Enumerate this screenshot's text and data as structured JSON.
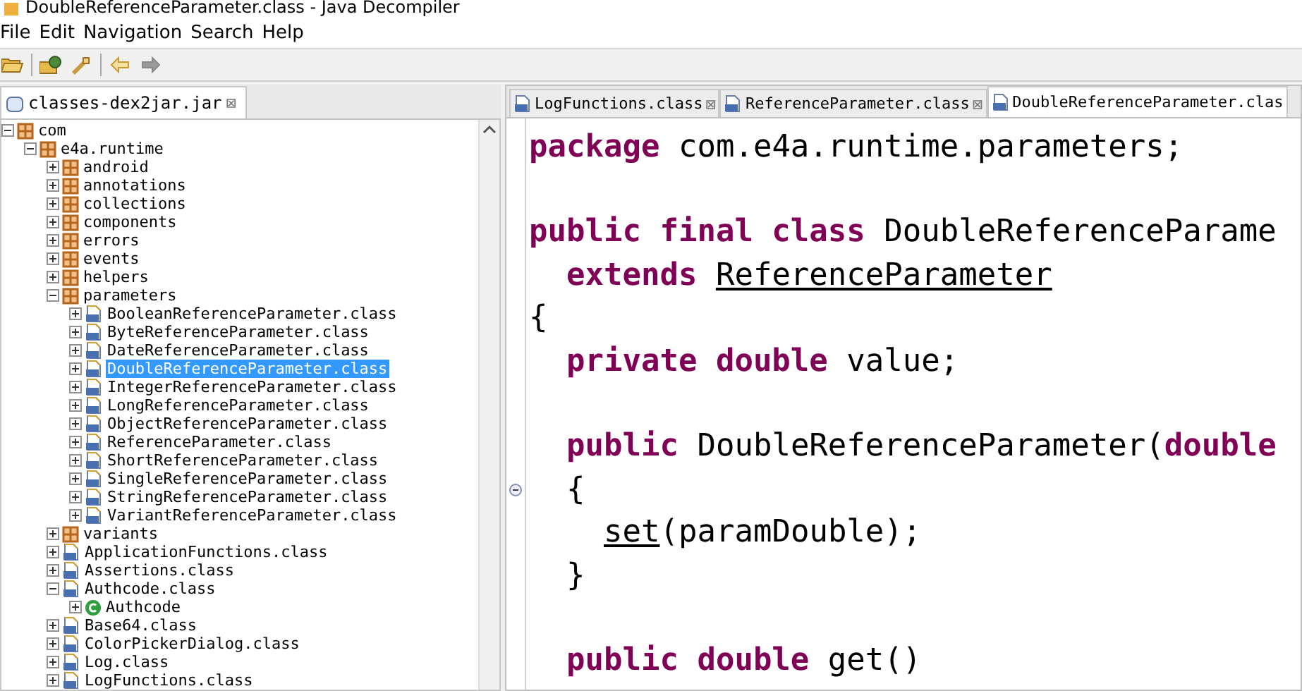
{
  "window": {
    "title": "DoubleReferenceParameter.class - Java Decompiler"
  },
  "menu": [
    "File",
    "Edit",
    "Navigation",
    "Search",
    "Help"
  ],
  "toolbar": {
    "back_enabled": true,
    "forward_enabled": false
  },
  "left_tab": {
    "label": "classes-dex2jar.jar",
    "close": "⊠"
  },
  "tree": [
    {
      "label": "com",
      "kind": "package",
      "expanded": true,
      "selected": false,
      "children": [
        {
          "label": "e4a.runtime",
          "kind": "package",
          "expanded": true,
          "selected": false,
          "children": [
            {
              "label": "android",
              "kind": "package",
              "expanded": false,
              "selected": false
            },
            {
              "label": "annotations",
              "kind": "package",
              "expanded": false,
              "selected": false
            },
            {
              "label": "collections",
              "kind": "package",
              "expanded": false,
              "selected": false
            },
            {
              "label": "components",
              "kind": "package",
              "expanded": false,
              "selected": false
            },
            {
              "label": "errors",
              "kind": "package",
              "expanded": false,
              "selected": false
            },
            {
              "label": "events",
              "kind": "package",
              "expanded": false,
              "selected": false
            },
            {
              "label": "helpers",
              "kind": "package",
              "expanded": false,
              "selected": false
            },
            {
              "label": "parameters",
              "kind": "package",
              "expanded": true,
              "selected": false,
              "children": [
                {
                  "label": "BooleanReferenceParameter.class",
                  "kind": "file",
                  "expanded": false,
                  "selected": false
                },
                {
                  "label": "ByteReferenceParameter.class",
                  "kind": "file",
                  "expanded": false,
                  "selected": false
                },
                {
                  "label": "DateReferenceParameter.class",
                  "kind": "file",
                  "expanded": false,
                  "selected": false
                },
                {
                  "label": "DoubleReferenceParameter.class",
                  "kind": "file",
                  "expanded": false,
                  "selected": true
                },
                {
                  "label": "IntegerReferenceParameter.class",
                  "kind": "file",
                  "expanded": false,
                  "selected": false
                },
                {
                  "label": "LongReferenceParameter.class",
                  "kind": "file",
                  "expanded": false,
                  "selected": false
                },
                {
                  "label": "ObjectReferenceParameter.class",
                  "kind": "file",
                  "expanded": false,
                  "selected": false
                },
                {
                  "label": "ReferenceParameter.class",
                  "kind": "file",
                  "expanded": false,
                  "selected": false
                },
                {
                  "label": "ShortReferenceParameter.class",
                  "kind": "file",
                  "expanded": false,
                  "selected": false
                },
                {
                  "label": "SingleReferenceParameter.class",
                  "kind": "file",
                  "expanded": false,
                  "selected": false
                },
                {
                  "label": "StringReferenceParameter.class",
                  "kind": "file",
                  "expanded": false,
                  "selected": false
                },
                {
                  "label": "VariantReferenceParameter.class",
                  "kind": "file",
                  "expanded": false,
                  "selected": false
                }
              ]
            },
            {
              "label": "variants",
              "kind": "package",
              "expanded": false,
              "selected": false
            },
            {
              "label": "ApplicationFunctions.class",
              "kind": "file",
              "expanded": false,
              "selected": false
            },
            {
              "label": "Assertions.class",
              "kind": "file",
              "expanded": false,
              "selected": false
            },
            {
              "label": "Authcode.class",
              "kind": "file",
              "expanded": true,
              "selected": false,
              "children": [
                {
                  "label": "Authcode",
                  "kind": "class",
                  "expanded": false,
                  "selected": false
                }
              ]
            },
            {
              "label": "Base64.class",
              "kind": "file",
              "expanded": false,
              "selected": false
            },
            {
              "label": "ColorPickerDialog.class",
              "kind": "file",
              "expanded": false,
              "selected": false
            },
            {
              "label": "Log.class",
              "kind": "file",
              "expanded": false,
              "selected": false
            },
            {
              "label": "LogFunctions.class",
              "kind": "file",
              "expanded": false,
              "selected": false
            }
          ]
        }
      ]
    }
  ],
  "editor_tabs": [
    {
      "label": "LogFunctions.class",
      "close": "⊠",
      "selected": false
    },
    {
      "label": "ReferenceParameter.class",
      "close": "⊠",
      "selected": false
    },
    {
      "label": "DoubleReferenceParameter.clas",
      "selected": true
    }
  ],
  "code": [
    {
      "kind": "code",
      "tokens": [
        {
          "text": "package",
          "kind": "keyword"
        },
        {
          "text": " com.e4a.runtime.parameters;",
          "kind": "plain"
        }
      ]
    },
    {
      "kind": "blank"
    },
    {
      "kind": "code",
      "tokens": [
        {
          "text": "public final class",
          "kind": "keyword"
        },
        {
          "text": " DoubleReferenceParame",
          "kind": "plain"
        }
      ]
    },
    {
      "kind": "code",
      "tokens": [
        {
          "text": "  extends ",
          "kind": "keyword"
        },
        {
          "text": "ReferenceParameter",
          "kind": "link"
        }
      ]
    },
    {
      "kind": "code",
      "tokens": [
        {
          "text": "{",
          "kind": "plain"
        }
      ]
    },
    {
      "kind": "code",
      "tokens": [
        {
          "text": "  private double",
          "kind": "keyword"
        },
        {
          "text": " value;",
          "kind": "plain"
        }
      ]
    },
    {
      "kind": "blank"
    },
    {
      "kind": "code",
      "tokens": [
        {
          "text": "  public",
          "kind": "keyword"
        },
        {
          "text": " DoubleReferenceParameter(",
          "kind": "plain"
        },
        {
          "text": "double",
          "kind": "keyword"
        }
      ]
    },
    {
      "kind": "code",
      "fold_marker": true,
      "tokens": [
        {
          "text": "  {",
          "kind": "plain"
        }
      ]
    },
    {
      "kind": "code",
      "tokens": [
        {
          "text": "    set",
          "kind": "link"
        },
        {
          "text": "(paramDouble);",
          "kind": "plain"
        }
      ]
    },
    {
      "kind": "code",
      "tokens": [
        {
          "text": "  }",
          "kind": "plain"
        }
      ]
    },
    {
      "kind": "blank"
    },
    {
      "kind": "code",
      "tokens": [
        {
          "text": "  public double",
          "kind": "keyword"
        },
        {
          "text": " get()",
          "kind": "plain"
        }
      ]
    }
  ]
}
